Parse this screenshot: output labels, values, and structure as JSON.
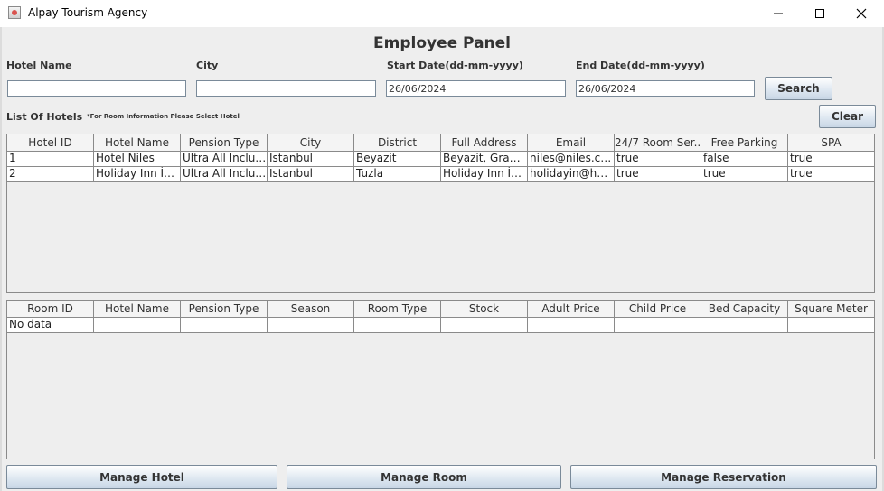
{
  "window": {
    "title": "Alpay Tourism Agency",
    "controls": [
      "minimize-icon",
      "maximize-icon",
      "close-icon"
    ]
  },
  "panel": {
    "title": "Employee Panel"
  },
  "search": {
    "hotel_name_label": "Hotel Name",
    "hotel_name_value": "",
    "city_label": "City",
    "city_value": "",
    "start_date_label": "Start Date(dd-mm-yyyy)",
    "start_date_value": "26/06/2024",
    "end_date_label": "End Date(dd-mm-yyyy)",
    "end_date_value": "26/06/2024",
    "search_button": "Search"
  },
  "hotels": {
    "label": "List Of Hotels",
    "hint": "*For Room Information Please Select Hotel",
    "clear_button": "Clear",
    "columns": [
      "Hotel ID",
      "Hotel Name",
      "Pension Type",
      "City",
      "District",
      "Full Address",
      "Email",
      "24/7 Room Ser...",
      "Free Parking",
      "SPA"
    ],
    "rows": [
      [
        "1",
        "Hotel Niles",
        "Ultra All Inclusive",
        "Istanbul",
        "Beyazit",
        "Beyazit, Grand ...",
        "niles@niles.com",
        "true",
        "false",
        "true"
      ],
      [
        "2",
        "Holiday Inn İst...",
        "Ultra All Inclusive",
        "Istanbul",
        "Tuzla",
        "Holiday Inn İsta...",
        "holidayin@holi...",
        "true",
        "true",
        "true"
      ]
    ]
  },
  "rooms": {
    "columns": [
      "Room ID",
      "Hotel Name",
      "Pension Type",
      "Season",
      "Room Type",
      "Stock",
      "Adult Price",
      "Child Price",
      "Bed Capacity",
      "Square Meter"
    ],
    "rows": [
      [
        "No data",
        "",
        "",
        "",
        "",
        "",
        "",
        "",
        "",
        ""
      ]
    ]
  },
  "footer": {
    "manage_hotel": "Manage Hotel",
    "manage_room": "Manage Room",
    "manage_reservation": "Manage Reservation"
  }
}
